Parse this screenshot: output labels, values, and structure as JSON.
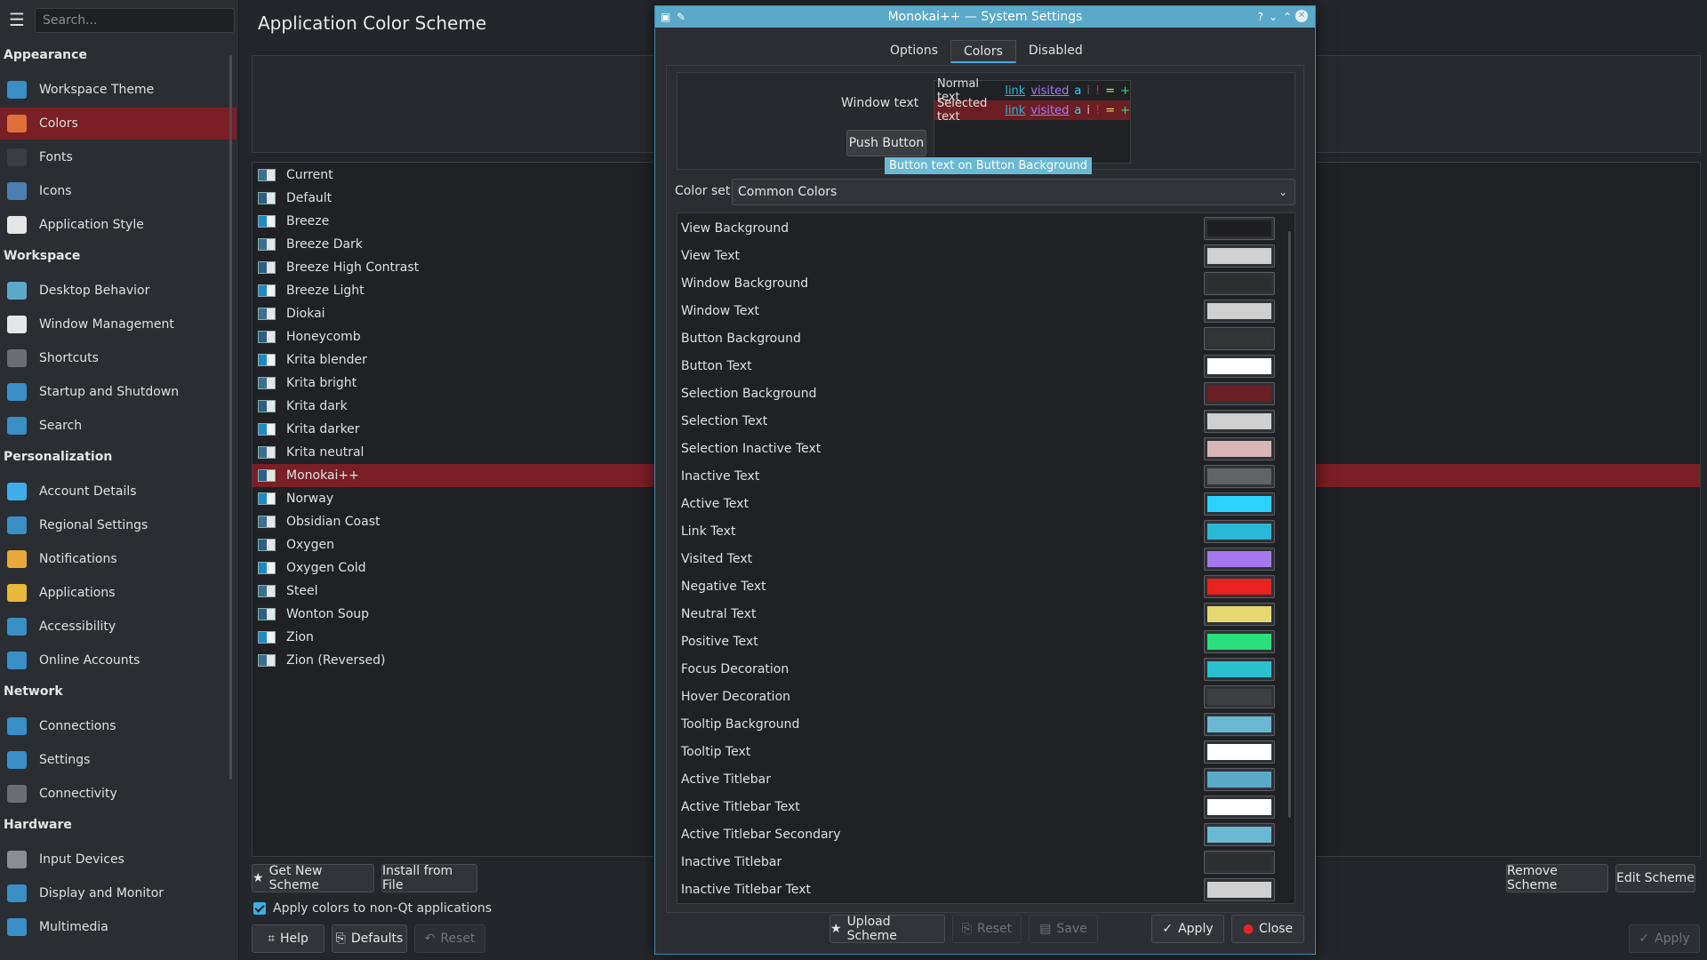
{
  "sidebar": {
    "search_placeholder": "Search...",
    "sections": [
      {
        "label": "Appearance",
        "items": [
          {
            "label": "Workspace Theme",
            "icon": "workspace-theme-icon",
            "color": "#3a8fc7"
          },
          {
            "label": "Colors",
            "icon": "colors-icon",
            "color": "#e0703a",
            "active": true
          },
          {
            "label": "Fonts",
            "icon": "fonts-icon",
            "color": "#3a3d42"
          },
          {
            "label": "Icons",
            "icon": "icons-icon",
            "color": "#4a7fb0"
          },
          {
            "label": "Application Style",
            "icon": "application-style-icon",
            "color": "#e6e6e6"
          }
        ]
      },
      {
        "label": "Workspace",
        "items": [
          {
            "label": "Desktop Behavior",
            "icon": "desktop-behavior-icon",
            "color": "#5aa9c9"
          },
          {
            "label": "Window Management",
            "icon": "window-management-icon",
            "color": "#e6e6e6"
          },
          {
            "label": "Shortcuts",
            "icon": "shortcuts-icon",
            "color": "#6a6d72"
          },
          {
            "label": "Startup and Shutdown",
            "icon": "startup-shutdown-icon",
            "color": "#3a8fc7"
          },
          {
            "label": "Search",
            "icon": "search-icon",
            "color": "#3a8fc7"
          }
        ]
      },
      {
        "label": "Personalization",
        "items": [
          {
            "label": "Account Details",
            "icon": "account-details-icon",
            "color": "#3daee9"
          },
          {
            "label": "Regional Settings",
            "icon": "regional-settings-icon",
            "color": "#3a8fc7"
          },
          {
            "label": "Notifications",
            "icon": "notifications-icon",
            "color": "#e8a93a"
          },
          {
            "label": "Applications",
            "icon": "applications-icon",
            "color": "#e8b83a"
          },
          {
            "label": "Accessibility",
            "icon": "accessibility-icon",
            "color": "#3a8fc7"
          },
          {
            "label": "Online Accounts",
            "icon": "online-accounts-icon",
            "color": "#3a8fc7"
          }
        ]
      },
      {
        "label": "Network",
        "items": [
          {
            "label": "Connections",
            "icon": "connections-icon",
            "color": "#3a8fc7"
          },
          {
            "label": "Settings",
            "icon": "network-settings-icon",
            "color": "#3a8fc7"
          },
          {
            "label": "Connectivity",
            "icon": "connectivity-icon",
            "color": "#6a6d72"
          }
        ]
      },
      {
        "label": "Hardware",
        "items": [
          {
            "label": "Input Devices",
            "icon": "input-devices-icon",
            "color": "#8a8d92"
          },
          {
            "label": "Display and Monitor",
            "icon": "display-monitor-icon",
            "color": "#3a8fc7"
          },
          {
            "label": "Multimedia",
            "icon": "multimedia-icon",
            "color": "#3a8fc7"
          }
        ]
      }
    ]
  },
  "main": {
    "title": "Application Color Scheme",
    "schemes": [
      "Current",
      "Default",
      "Breeze",
      "Breeze Dark",
      "Breeze High Contrast",
      "Breeze Light",
      "Diokai",
      "Honeycomb",
      "Krita blender",
      "Krita bright",
      "Krita dark",
      "Krita darker",
      "Krita neutral",
      "Monokai++",
      "Norway",
      "Obsidian Coast",
      "Oxygen",
      "Oxygen Cold",
      "Steel",
      "Wonton Soup",
      "Zion",
      "Zion (Reversed)"
    ],
    "selected_scheme": "Monokai++",
    "buttons": {
      "get_new": "Get New Scheme",
      "install": "Install from File",
      "remove": "Remove Scheme",
      "edit": "Edit Scheme",
      "help": "Help",
      "defaults": "Defaults",
      "reset": "Reset",
      "apply": "Apply"
    },
    "apply_non_qt": "Apply colors to non-Qt applications"
  },
  "dialog": {
    "title": "Monokai++ — System Settings",
    "tabs": [
      "Options",
      "Colors",
      "Disabled"
    ],
    "active_tab": "Colors",
    "preview": {
      "window_text": "Window text",
      "push_button": "Push Button",
      "normal_text": "Normal text",
      "selected_text": "Selected text",
      "link": "link",
      "visited": "visited",
      "a": "a",
      "i": "i",
      "excl": "!",
      "eq": "=",
      "plus": "+",
      "tooltip": "Button text on Button Background"
    },
    "color_set_label": "Color set:",
    "color_set_value": "Common Colors",
    "colors": [
      {
        "name": "View Background",
        "color": "#1f1f21"
      },
      {
        "name": "View Text",
        "color": "#cfcfcf"
      },
      {
        "name": "Window Background",
        "color": "#2d2e30"
      },
      {
        "name": "Window Text",
        "color": "#cfcfcf"
      },
      {
        "name": "Button Background",
        "color": "#343537"
      },
      {
        "name": "Button Text",
        "color": "#ffffff"
      },
      {
        "name": "Selection Background",
        "color": "#6b1f22"
      },
      {
        "name": "Selection Text",
        "color": "#cfcfcf"
      },
      {
        "name": "Selection Inactive Text",
        "color": "#d8b6b6"
      },
      {
        "name": "Inactive Text",
        "color": "#626366"
      },
      {
        "name": "Active Text",
        "color": "#2bd2ff"
      },
      {
        "name": "Link Text",
        "color": "#2bb7d6"
      },
      {
        "name": "Visited Text",
        "color": "#a678f0"
      },
      {
        "name": "Negative Text",
        "color": "#e8231f"
      },
      {
        "name": "Neutral Text",
        "color": "#e6d871"
      },
      {
        "name": "Positive Text",
        "color": "#29e07a"
      },
      {
        "name": "Focus Decoration",
        "color": "#2bc0cf"
      },
      {
        "name": "Hover Decoration",
        "color": "#3f4043"
      },
      {
        "name": "Tooltip Background",
        "color": "#6ab8d2"
      },
      {
        "name": "Tooltip Text",
        "color": "#ffffff"
      },
      {
        "name": "Active Titlebar",
        "color": "#5aa9c9"
      },
      {
        "name": "Active Titlebar Text",
        "color": "#ffffff"
      },
      {
        "name": "Active Titlebar Secondary",
        "color": "#6ab8d2"
      },
      {
        "name": "Inactive Titlebar",
        "color": "#2d2e30"
      },
      {
        "name": "Inactive Titlebar Text",
        "color": "#cfcfcf"
      }
    ],
    "buttons": {
      "upload": "Upload Scheme",
      "reset": "Reset",
      "save": "Save",
      "apply": "Apply",
      "close": "Close"
    }
  }
}
